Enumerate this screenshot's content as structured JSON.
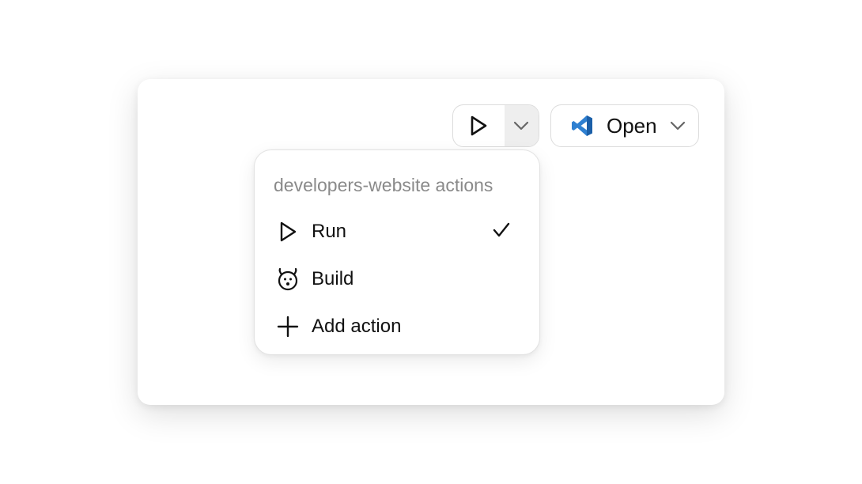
{
  "toolbar": {
    "run_icon": "play-icon",
    "toggle_icon": "chevron-down-icon",
    "open_label": "Open",
    "open_icon": "vscode-icon",
    "open_chevron_icon": "chevron-down-icon"
  },
  "menu": {
    "header": "developers-website actions",
    "items": [
      {
        "label": "Run",
        "icon": "play-icon",
        "selected": true
      },
      {
        "label": "Build",
        "icon": "build-icon",
        "selected": false
      },
      {
        "label": "Add action",
        "icon": "plus-icon",
        "selected": false
      }
    ]
  },
  "colors": {
    "vscode_blue": "#2F80D1",
    "vscode_dark": "#1B5FA8",
    "header_text": "#8a8a8a",
    "toggle_bg": "#eeeeee"
  }
}
